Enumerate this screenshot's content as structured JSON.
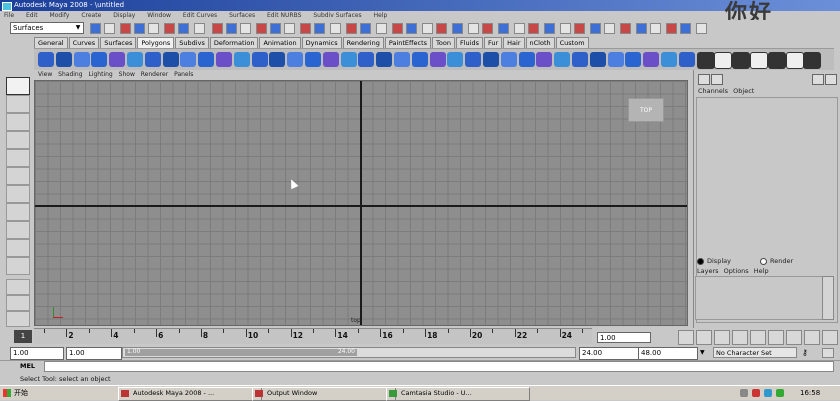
{
  "window": {
    "title": "Autodesk Maya 2008 - \\untitled",
    "menus": [
      "File",
      "Edit",
      "Modify",
      "Create",
      "Display",
      "Window",
      "Edit Curves",
      "Surfaces",
      "Edit NURBS",
      "Subdiv Surfaces",
      "Help"
    ]
  },
  "watermark": "你好",
  "status_line": {
    "mode_selected": "Surfaces"
  },
  "shelf": {
    "tabs": [
      "General",
      "Curves",
      "Surfaces",
      "Polygons",
      "Subdivs",
      "Deformation",
      "Animation",
      "Dynamics",
      "Rendering",
      "PaintEffects",
      "Toon",
      "Fluids",
      "Fur",
      "Hair",
      "nCloth",
      "Custom"
    ],
    "active_tab": "Polygons"
  },
  "panel": {
    "menus": [
      "View",
      "Shading",
      "Lighting",
      "Show",
      "Renderer",
      "Panels"
    ],
    "view_cube_label": "TOP",
    "camera_label": "top"
  },
  "channel_box": {
    "menus": [
      "Channels",
      "Object"
    ]
  },
  "layer_editor": {
    "display_label": "Display",
    "render_label": "Render",
    "selected": "Display",
    "menus": [
      "Layers",
      "Options",
      "Help"
    ]
  },
  "time_slider": {
    "ticks": [
      "2",
      "4",
      "6",
      "8",
      "10",
      "12",
      "14",
      "16",
      "18",
      "20",
      "22",
      "24"
    ],
    "current_frame_box": "1",
    "current_time": "1.00"
  },
  "range_slider": {
    "start_time": "1.00",
    "playback_start": "1.00",
    "range_start": "1.00",
    "range_end": "24.00",
    "end_time": "24.00",
    "playback_end": "48.00",
    "character_set": "No Character Set"
  },
  "command_line": {
    "label": "MEL",
    "value": ""
  },
  "help_line": {
    "text": "Select Tool: select an object"
  },
  "taskbar": {
    "start_label": "开始",
    "tasks": [
      "Autodesk Maya 2008 - ...",
      "Output Window",
      "Camtasia Studio - U..."
    ],
    "clock": "16:58"
  },
  "colors": {
    "viewport_bg": "#8e8e8e",
    "grid_line": "#7c7c7c",
    "axis": "#1a1a1a",
    "titlebar": "#1c3f9a",
    "shelf_icon": "#2f5fc8"
  }
}
